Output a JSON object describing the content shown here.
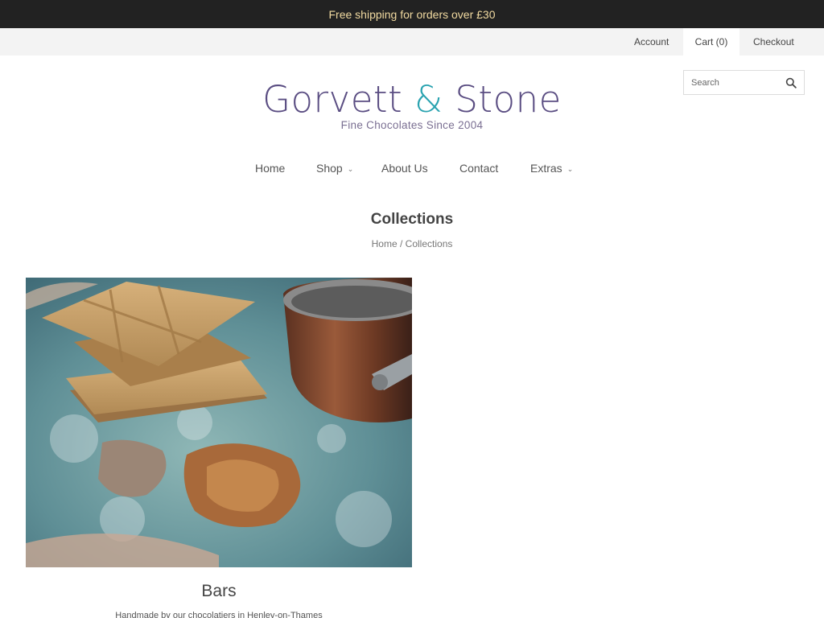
{
  "announcement": "Free shipping for orders over £30",
  "topbar": {
    "account": "Account",
    "cart": "Cart (0)",
    "checkout": "Checkout"
  },
  "search": {
    "placeholder": "Search"
  },
  "logo": {
    "brand_first": "Gorvett ",
    "brand_amp": "&",
    "brand_last": " Stone",
    "tagline": "Fine Chocolates Since 2004"
  },
  "nav": [
    {
      "label": "Home"
    },
    {
      "label": "Shop",
      "dropdown": true
    },
    {
      "label": "About Us"
    },
    {
      "label": "Contact"
    },
    {
      "label": "Extras",
      "dropdown": true
    }
  ],
  "page": {
    "title": "Collections",
    "breadcrumb": {
      "home": "Home",
      "separator": "/",
      "current": "Collections"
    }
  },
  "collections": [
    {
      "name": "Bars",
      "description": "Handmade by our chocolatiers in Henley-on-Thames"
    }
  ],
  "colors": {
    "announcement_bg": "#222222",
    "announcement_text": "#f0d9a0",
    "brand_purple": "#5a4d82",
    "brand_teal": "#2aa3b0"
  }
}
